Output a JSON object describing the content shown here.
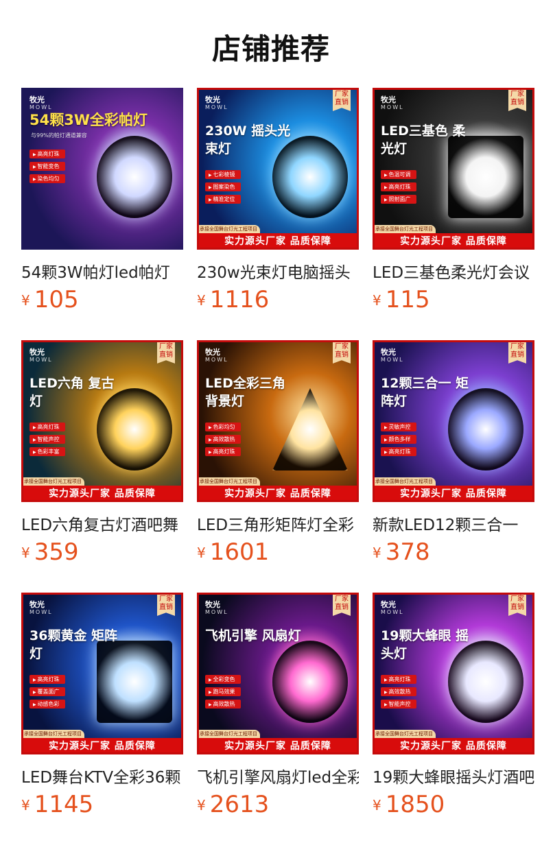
{
  "page": {
    "title": "店铺推荐"
  },
  "card_common": {
    "brand_cn": "牧光",
    "brand_en": "MOWL",
    "badge": "厂家直销",
    "strip_top": "承接全国舞台灯光工程项目",
    "strip": "实力源头厂家 品质保障",
    "currency": "¥"
  },
  "products": [
    {
      "name": "54颗3W帕灯led帕灯",
      "price": "105",
      "headline": "54颗3W全彩帕灯",
      "subline": "与99%的帕灯通道兼容",
      "features": [
        "高亮灯珠",
        "智能变色",
        "染色均匀"
      ],
      "bg1": "#1c1657",
      "bg2": "#7a2fa8",
      "accent": "#d0d8ff"
    },
    {
      "name": "230w光束灯电脑摇头",
      "price": "1116",
      "headline": "230W 摇头光束灯",
      "features": [
        "七彩棱镜",
        "图案染色",
        "精准定位"
      ],
      "bg1": "#0a1e5c",
      "bg2": "#1c8de0",
      "accent": "#8fd6ff"
    },
    {
      "name": "LED三基色柔光灯会议",
      "price": "115",
      "headline": "LED三基色 柔光灯",
      "features": [
        "色温可调",
        "高亮灯珠",
        "照射面广"
      ],
      "bg1": "#101010",
      "bg2": "#3a3a3a",
      "accent": "#f4f4f4"
    },
    {
      "name": "LED六角复古灯酒吧舞",
      "price": "359",
      "headline": "LED六角 复古灯",
      "features": [
        "高亮灯珠",
        "智能声控",
        "色彩丰富"
      ],
      "bg1": "#0b2a3a",
      "bg2": "#b87a12",
      "accent": "#ffd25c"
    },
    {
      "name": "LED三角形矩阵灯全彩",
      "price": "1601",
      "headline": "LED全彩三角 背景灯",
      "features": [
        "色彩均匀",
        "高效散热",
        "高亮灯珠"
      ],
      "bg1": "#2a1205",
      "bg2": "#c86a10",
      "accent": "#ffe3a0"
    },
    {
      "name": "新款LED12颗三合一",
      "price": "378",
      "headline": "12颗三合一 矩阵灯",
      "features": [
        "灵敏声控",
        "颜色多样",
        "高亮灯珠"
      ],
      "bg1": "#1a1250",
      "bg2": "#7c3fd0",
      "accent": "#9aa8ff"
    },
    {
      "name": "LED舞台KTV全彩36颗",
      "price": "1145",
      "headline": "36颗黄金 矩阵灯",
      "features": [
        "高亮灯珠",
        "覆盖面广",
        "动感色彩"
      ],
      "bg1": "#08133f",
      "bg2": "#1f54c8",
      "accent": "#bfe0ff"
    },
    {
      "name": "飞机引擎风扇灯led全彩",
      "price": "2613",
      "headline": "飞机引擎 风扇灯",
      "features": [
        "全彩变色",
        "跑马效果",
        "高效散热"
      ],
      "bg1": "#0a0a1e",
      "bg2": "#6a1a8a",
      "accent": "#ff6ad0"
    },
    {
      "name": "19颗大蜂眼摇头灯酒吧",
      "price": "1850",
      "headline": "19颗大蜂眼 摇头灯",
      "features": [
        "高亮灯珠",
        "高效散热",
        "智能声控"
      ],
      "bg1": "#1a0d4a",
      "bg2": "#b23ad8",
      "accent": "#e8e8ff"
    }
  ]
}
